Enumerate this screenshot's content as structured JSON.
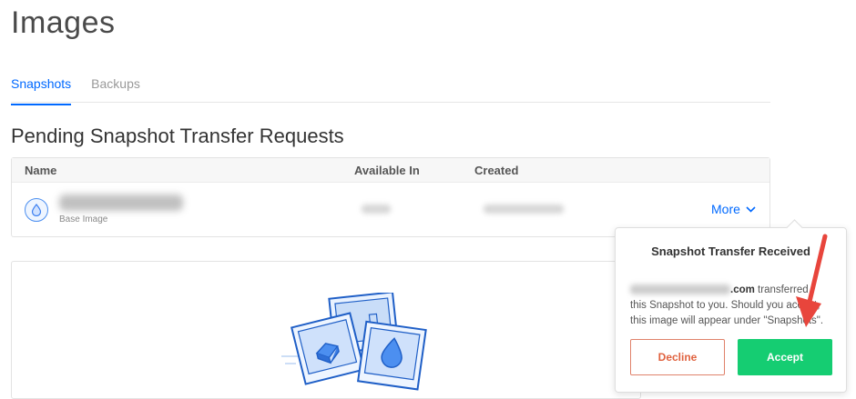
{
  "page": {
    "title": "Images"
  },
  "tabs": [
    {
      "label": "Snapshots",
      "active": true
    },
    {
      "label": "Backups",
      "active": false
    }
  ],
  "section": {
    "title": "Pending Snapshot Transfer Requests"
  },
  "table": {
    "columns": [
      "Name",
      "Available In",
      "Created"
    ],
    "rows": [
      {
        "sub_label": "Base Image",
        "action_label": "More"
      }
    ]
  },
  "popover": {
    "title": "Snapshot Transfer Received",
    "email_suffix": ".com",
    "message_line1": " transferred",
    "message_line2": "this Snapshot to you. Should you accept,",
    "message_line3": "this image will appear under \"Snapshots\".",
    "decline_label": "Decline",
    "accept_label": "Accept"
  },
  "colors": {
    "accent": "#0069ff",
    "accept": "#15cd72",
    "decline": "#e0623f",
    "annotation_arrow": "#e8453c"
  },
  "icons": {
    "row_icon": "droplet-icon",
    "chevron": "chevron-down-icon",
    "annotation": "red-arrow-icon"
  }
}
